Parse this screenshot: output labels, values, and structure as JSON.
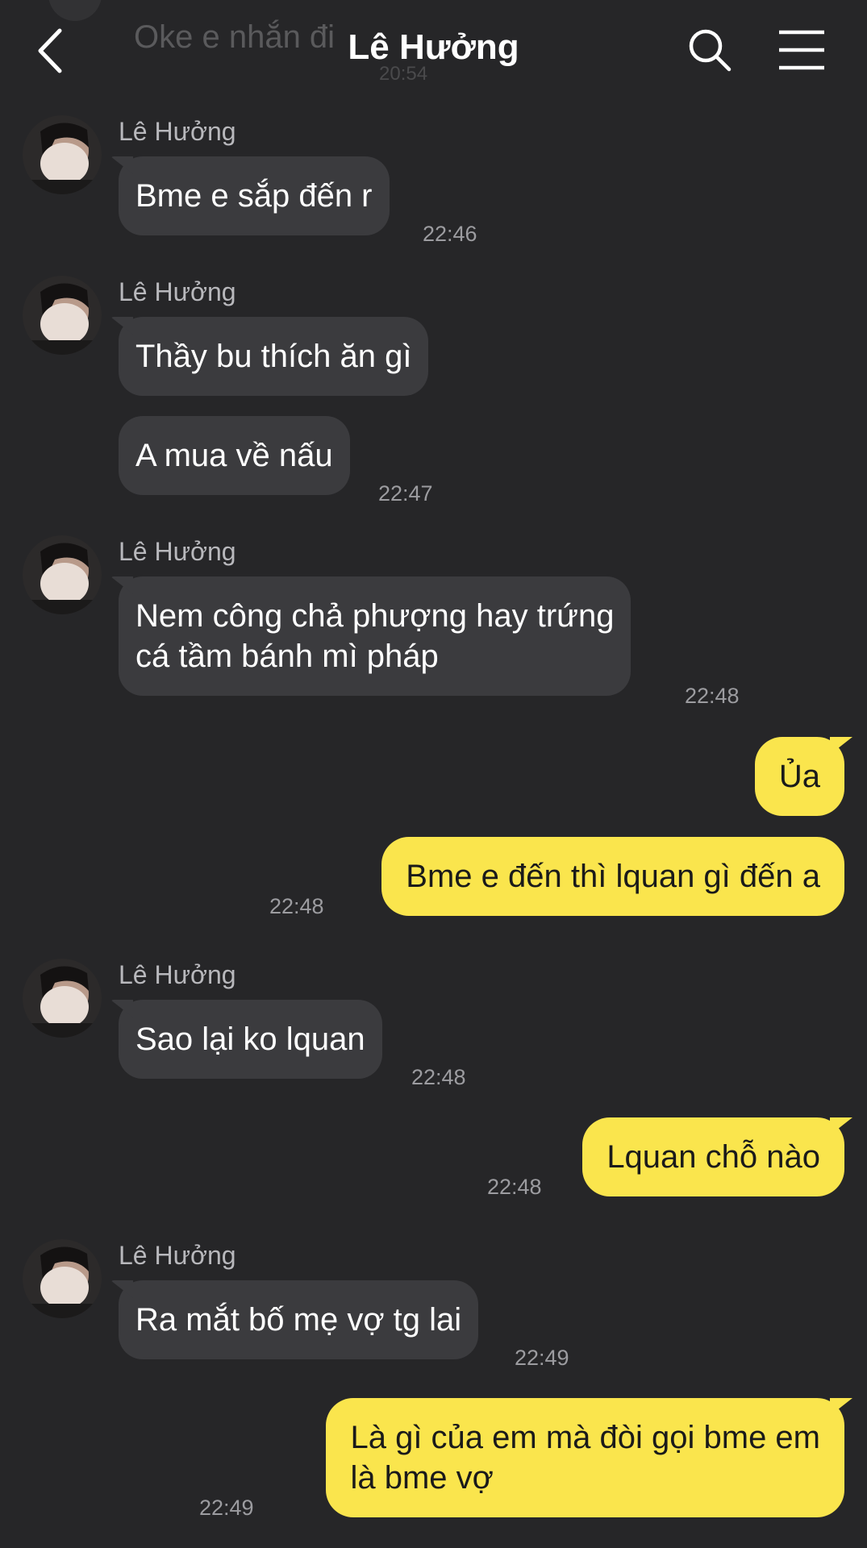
{
  "header": {
    "title": "Lê Hưởng",
    "prev_message_faded": "Oke e nhắn đi",
    "prev_time_faded": "20:54"
  },
  "messages": [
    {
      "sender": "Lê Hưởng",
      "text": "Bme e sắp đến r",
      "time": "22:46",
      "direction": "in"
    },
    {
      "sender": "Lê Hưởng",
      "text": "Thầy bu thích ăn gì",
      "direction": "in"
    },
    {
      "text": "A mua về nấu",
      "time": "22:47",
      "direction": "in"
    },
    {
      "sender": "Lê Hưởng",
      "text_line1": "Nem công chả phượng hay trứng",
      "text_line2": "cá tầm bánh mì pháp",
      "time": "22:48",
      "direction": "in"
    },
    {
      "text": "Ủa",
      "direction": "out"
    },
    {
      "text": "Bme e đến thì lquan gì đến a",
      "time": "22:48",
      "direction": "out"
    },
    {
      "sender": "Lê Hưởng",
      "text": "Sao lại ko lquan",
      "time": "22:48",
      "direction": "in"
    },
    {
      "text": "Lquan chỗ nào",
      "time": "22:48",
      "direction": "out"
    },
    {
      "sender": "Lê Hưởng",
      "text": "Ra mắt bố mẹ vợ tg lai",
      "time": "22:49",
      "direction": "in"
    },
    {
      "text_line1": "Là gì của em mà đòi gọi bme em",
      "text_line2": "là bme vợ",
      "time": "22:49",
      "direction": "out"
    }
  ],
  "colors": {
    "background": "#262628",
    "incoming_bubble": "#3b3b3e",
    "outgoing_bubble": "#fae54d",
    "timestamp": "#9c9ca0"
  },
  "icons": [
    "back-arrow-icon",
    "search-icon",
    "menu-icon",
    "avatar-photo"
  ]
}
